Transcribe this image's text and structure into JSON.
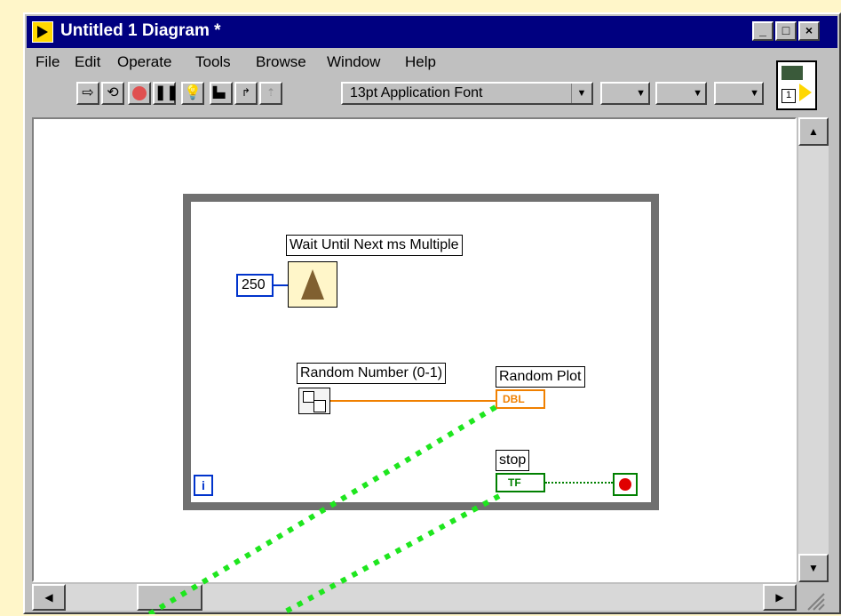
{
  "window": {
    "title": "Untitled 1 Diagram *",
    "controls": {
      "minimize": "_",
      "maximize": "□",
      "close": "×"
    }
  },
  "menus": [
    "File",
    "Edit",
    "Operate",
    "Tools",
    "Browse",
    "Window",
    "Help"
  ],
  "toolbar": {
    "font_selector": "13pt Application Font",
    "buttons": [
      "run-arrow-icon",
      "run-continuous-icon",
      "abort-icon",
      "pause-icon",
      "highlight-execution-icon",
      "step-into-icon",
      "step-over-icon",
      "step-out-icon",
      "align-icon",
      "distribute-icon",
      "reorder-icon"
    ]
  },
  "diagram": {
    "wait_label": "Wait Until Next ms Multiple",
    "constant_value": "250",
    "random_label": "Random Number (0-1)",
    "plot_label": "Random Plot",
    "plot_terminal": "DBL",
    "stop_label": "stop",
    "stop_terminal": "TF",
    "iteration": "i"
  },
  "colors": {
    "accent": "#000080",
    "numeric_wire": "#f08000",
    "int_wire": "#0033cc",
    "bool_wire": "#008000",
    "annotation": "#1ee61e"
  }
}
